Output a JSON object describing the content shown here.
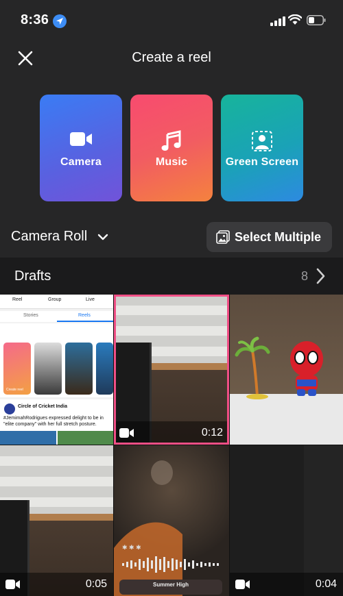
{
  "status_bar": {
    "time": "8:36"
  },
  "header": {
    "title": "Create a reel"
  },
  "modes": [
    {
      "label": "Camera",
      "icon": "video-camera-icon"
    },
    {
      "label": "Music",
      "icon": "music-note-icon"
    },
    {
      "label": "Green Screen",
      "icon": "green-screen-icon"
    }
  ],
  "album": {
    "name": "Camera Roll",
    "select_multiple_label": "Select Multiple"
  },
  "drafts": {
    "label": "Drafts",
    "count": "8"
  },
  "grid": {
    "tiles": [
      {
        "type": "image",
        "description_icon": "facebook-screenshot"
      },
      {
        "type": "video",
        "duration": "0:12",
        "selected": true
      },
      {
        "type": "image"
      },
      {
        "type": "video",
        "duration": "0:05"
      },
      {
        "type": "image"
      },
      {
        "type": "video",
        "duration": "0:04"
      }
    ],
    "fb_screenshot": {
      "chips": [
        "Reel",
        "Group",
        "Live"
      ],
      "tabs": [
        "Stories",
        "Reels"
      ],
      "create_reel": "Create reel",
      "post_author": "Circle of Cricket India",
      "post_text": "#JemimahRodrigues expressed delight to be in \"elite company\" with her full stretch posture."
    },
    "music_tile": {
      "song_title": "Summer High"
    }
  },
  "colors": {
    "camera_card": "#4f6be6",
    "music_card": "#f55a65",
    "green_card": "#1aa7b0",
    "selection_border": "#f14f86"
  }
}
